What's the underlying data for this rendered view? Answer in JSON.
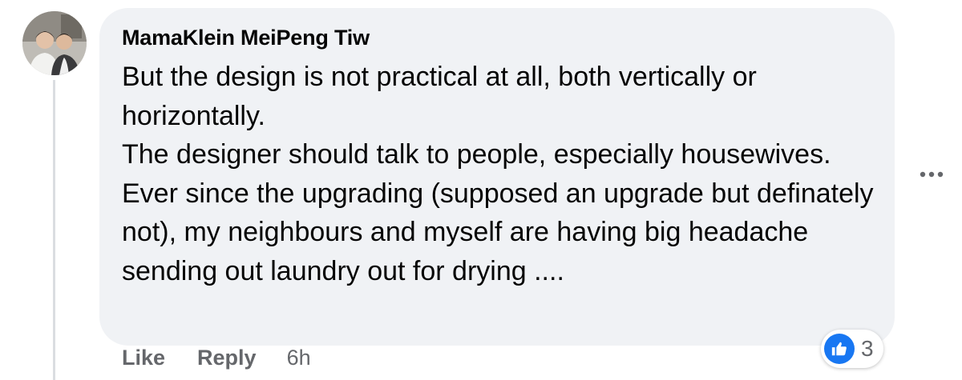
{
  "comment": {
    "author": "MamaKlein MeiPeng Tiw",
    "paragraphs": [
      "But the design is not practical at all, both vertically or horizontally.",
      "The designer should talk to people, especially housewives.",
      "Ever since the upgrading (supposed an upgrade but definately not), my neighbours and myself are having big headache sending out laundry out for drying ...."
    ],
    "actions": {
      "like_label": "Like",
      "reply_label": "Reply",
      "time": "6h"
    },
    "reactions": {
      "icon": "thumbs-up-icon",
      "count": "3"
    },
    "more_icon": "ellipsis-icon"
  },
  "colors": {
    "bubble_bg": "#f0f2f5",
    "text": "#050505",
    "secondary_text": "#65676b",
    "like_blue": "#1877f2"
  }
}
